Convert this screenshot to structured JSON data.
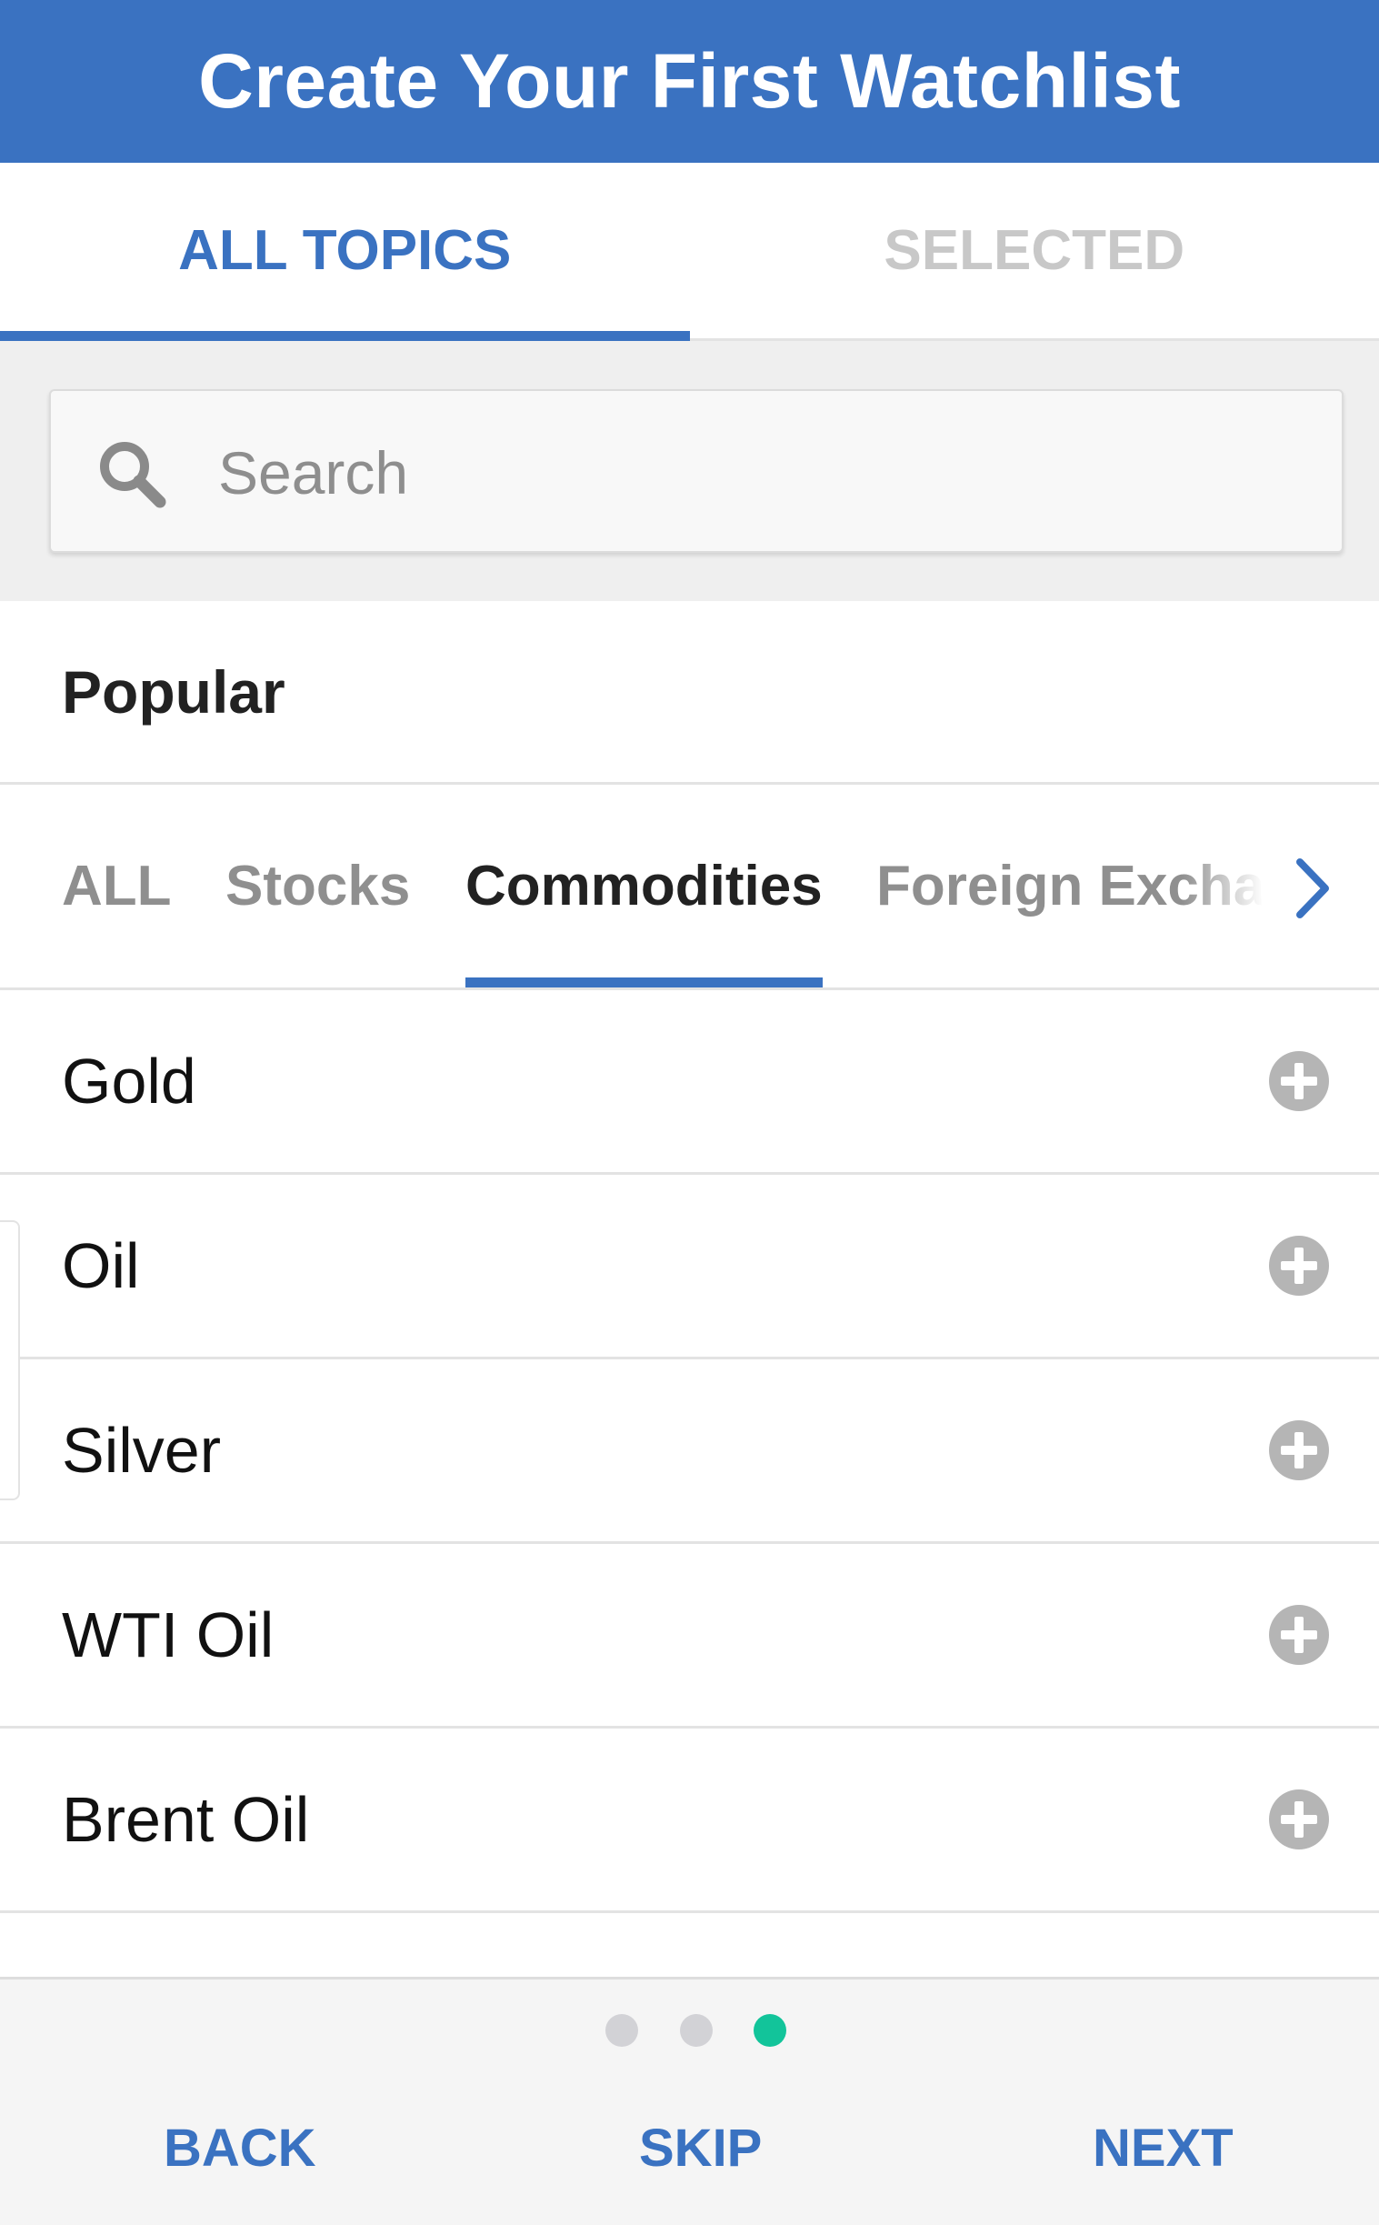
{
  "header": {
    "title": "Create Your First Watchlist"
  },
  "tabs": [
    {
      "label": "ALL TOPICS",
      "active": true
    },
    {
      "label": "SELECTED",
      "active": false
    }
  ],
  "search": {
    "placeholder": "Search",
    "value": ""
  },
  "section": {
    "title": "Popular"
  },
  "categories": [
    {
      "label": "ALL",
      "active": false
    },
    {
      "label": "Stocks",
      "active": false
    },
    {
      "label": "Commodities",
      "active": true
    },
    {
      "label": "Foreign Exchange",
      "active": false
    }
  ],
  "items": [
    {
      "label": "Gold"
    },
    {
      "label": "Oil"
    },
    {
      "label": "Silver"
    },
    {
      "label": "WTI Oil"
    },
    {
      "label": "Brent Oil"
    }
  ],
  "pagination": {
    "total": 3,
    "current": 3
  },
  "footer": {
    "back": "BACK",
    "skip": "SKIP",
    "next": "NEXT"
  },
  "colors": {
    "brand": "#3a72c1",
    "dot_active": "#12c49a",
    "dot_inactive": "#d2d2d6",
    "icon_gray": "#b5b5b5"
  },
  "icons": {
    "search": "search-icon",
    "more_categories": "chevron-right-icon",
    "add": "plus-circle-icon"
  }
}
